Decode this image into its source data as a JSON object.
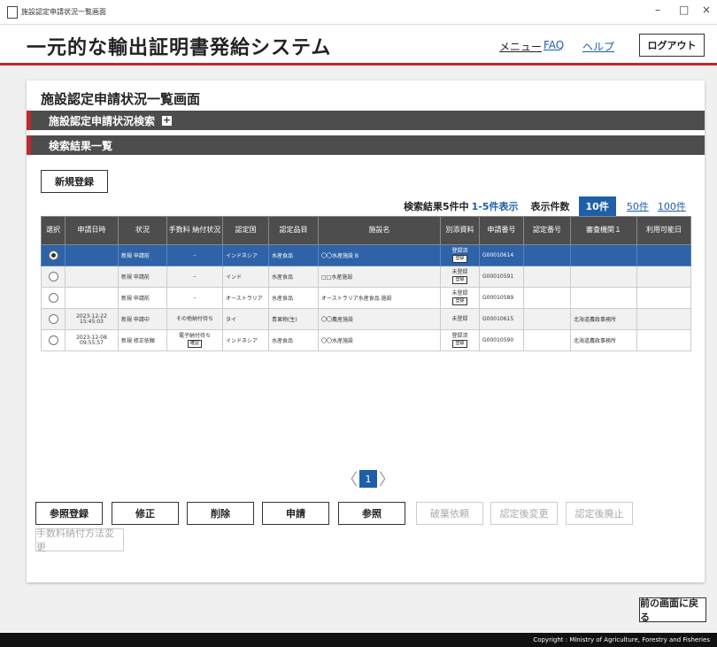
{
  "window": {
    "title": "施設認定申請状況一覧画面",
    "min": "–",
    "max": "□",
    "close": "×"
  },
  "header": {
    "app_title": "一元的な輸出証明書発給システム",
    "menu": "メニュー",
    "faq": "FAQ",
    "help": "ヘルプ",
    "logout": "ログアウト"
  },
  "page": {
    "title": "施設認定申請状況一覧画面",
    "search_section": "施設認定申請状況検索",
    "search_toggle": "+",
    "results_section": "検索結果一覧",
    "new_button": "新規登録"
  },
  "results": {
    "count_label": "検索結果5件中",
    "range_label": "1-5件表示",
    "per_page_label": "表示件数",
    "per_page_options": [
      "10件",
      "50件",
      "100件"
    ],
    "per_page_selected": "10件"
  },
  "table": {
    "headers": [
      "選択",
      "申請日時",
      "状況",
      "手数料 納付状況",
      "認定国",
      "認定品目",
      "施設名",
      "別添資料",
      "申請番号",
      "認定番号",
      "審査機関１",
      "利用可能日"
    ],
    "rows": [
      {
        "selected": true,
        "date": "",
        "status": "新規 申請前",
        "fee": "–",
        "fee_btn": "",
        "country": "インドネシア",
        "item": "水産食品",
        "facility": "〇〇水産施設 B",
        "attach_top": "登録済",
        "attach_btn": "登録",
        "appno": "G00010614",
        "certno": "",
        "agency": "",
        "avail": ""
      },
      {
        "selected": false,
        "date": "",
        "status": "新規 申請前",
        "fee": "–",
        "fee_btn": "",
        "country": "インド",
        "item": "水産食品",
        "facility": "□□水産施設",
        "attach_top": "未登録",
        "attach_btn": "登録",
        "appno": "G00010591",
        "certno": "",
        "agency": "",
        "avail": ""
      },
      {
        "selected": false,
        "date": "",
        "status": "新規 申請前",
        "fee": "–",
        "fee_btn": "",
        "country": "オーストラリア",
        "item": "水産食品",
        "facility": "オーストラリア水産食品 施設",
        "attach_top": "未登録",
        "attach_btn": "登録",
        "appno": "G00010589",
        "certno": "",
        "agency": "",
        "avail": ""
      },
      {
        "selected": false,
        "date": "2023-12-22 15:45:03",
        "status": "新規 申請中",
        "fee": "その他納付待ち",
        "fee_btn": "",
        "country": "タイ",
        "item": "青果物(生)",
        "facility": "〇〇農産施設",
        "attach_top": "未登録",
        "attach_btn": "",
        "appno": "G00010615",
        "certno": "",
        "agency": "北海道農政事務所",
        "avail": ""
      },
      {
        "selected": false,
        "date": "2023-12-08 09:55:57",
        "status": "新規 修正依頼",
        "fee": "電子納付待ち",
        "fee_btn": "確認",
        "country": "インドネシア",
        "item": "水産食品",
        "facility": "〇〇水産施設",
        "attach_top": "登録済",
        "attach_btn": "登録",
        "appno": "G00010590",
        "certno": "",
        "agency": "北海道農政事務所",
        "avail": ""
      }
    ]
  },
  "pager": {
    "prev": "〈",
    "current": "1",
    "next": "〉"
  },
  "actions": {
    "ref_register": "参照登録",
    "edit": "修正",
    "delete": "削除",
    "apply": "申請",
    "view": "参照",
    "discard_request": "破棄依頼",
    "post_change": "認定後変更",
    "post_abolish": "認定後廃止",
    "fee_method_change": "手数料納付方法変更"
  },
  "back_button": "前の画面に戻る",
  "footer": "Copyright : Ministry of Agriculture, Forestry and Fisheries",
  "colors": {
    "accent_red": "#c0282e",
    "selected_blue": "#2e63a8",
    "header_gray": "#4d4d4d"
  }
}
